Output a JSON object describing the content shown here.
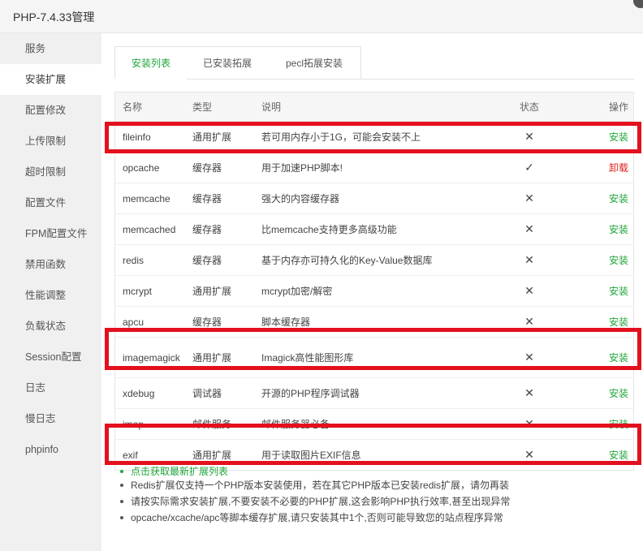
{
  "window": {
    "title": "PHP-7.4.33管理"
  },
  "sidebar": {
    "items": [
      {
        "label": "服务"
      },
      {
        "label": "安装扩展"
      },
      {
        "label": "配置修改"
      },
      {
        "label": "上传限制"
      },
      {
        "label": "超时限制"
      },
      {
        "label": "配置文件"
      },
      {
        "label": "FPM配置文件"
      },
      {
        "label": "禁用函数"
      },
      {
        "label": "性能调整"
      },
      {
        "label": "负载状态"
      },
      {
        "label": "Session配置"
      },
      {
        "label": "日志"
      },
      {
        "label": "慢日志"
      },
      {
        "label": "phpinfo"
      }
    ],
    "active_index": 1
  },
  "tabs": [
    {
      "label": "安装列表"
    },
    {
      "label": "已安装拓展"
    },
    {
      "label": "pecl拓展安装"
    }
  ],
  "table": {
    "headers": {
      "name": "名称",
      "type": "类型",
      "desc": "说明",
      "status": "状态",
      "op": "操作"
    },
    "rows": [
      {
        "name": "fileinfo",
        "type": "通用扩展",
        "desc": "若可用内存小于1G，可能会安装不上",
        "status": "✕",
        "op": "安装"
      },
      {
        "name": "opcache",
        "type": "缓存器",
        "desc": "用于加速PHP脚本!",
        "status": "✓",
        "op": "卸载"
      },
      {
        "name": "memcache",
        "type": "缓存器",
        "desc": "强大的内容缓存器",
        "status": "✕",
        "op": "安装"
      },
      {
        "name": "memcached",
        "type": "缓存器",
        "desc": "比memcache支持更多高级功能",
        "status": "✕",
        "op": "安装"
      },
      {
        "name": "redis",
        "type": "缓存器",
        "desc": "基于内存亦可持久化的Key-Value数据库",
        "status": "✕",
        "op": "安装"
      },
      {
        "name": "mcrypt",
        "type": "通用扩展",
        "desc": "mcrypt加密/解密",
        "status": "✕",
        "op": "安装"
      },
      {
        "name": "apcu",
        "type": "缓存器",
        "desc": "脚本缓存器",
        "status": "✕",
        "op": "安装"
      },
      {
        "name": "imagemagick",
        "type": "通用扩展",
        "desc": "Imagick高性能图形库",
        "status": "✕",
        "op": "安装"
      },
      {
        "name": "xdebug",
        "type": "调试器",
        "desc": "开源的PHP程序调试器",
        "status": "✕",
        "op": "安装"
      },
      {
        "name": "imap",
        "type": "邮件服务",
        "desc": "邮件服务器必备",
        "status": "✕",
        "op": "安装"
      },
      {
        "name": "exif",
        "type": "通用扩展",
        "desc": "用于读取图片EXIF信息",
        "status": "✕",
        "op": "安装"
      }
    ]
  },
  "notes": [
    "点击获取最新扩展列表",
    "Redis扩展仅支持一个PHP版本安装使用，若在其它PHP版本已安装redis扩展，请勿再装",
    "请按实际需求安装扩展,不要安装不必要的PHP扩展,这会影响PHP执行效率,甚至出现异常",
    "opcache/xcache/apc等脚本缓存扩展,请只安装其中1个,否则可能导致您的站点程序异常"
  ],
  "colors": {
    "accent": "#20a53a",
    "danger": "#e02020",
    "highlight": "#e3101e"
  }
}
